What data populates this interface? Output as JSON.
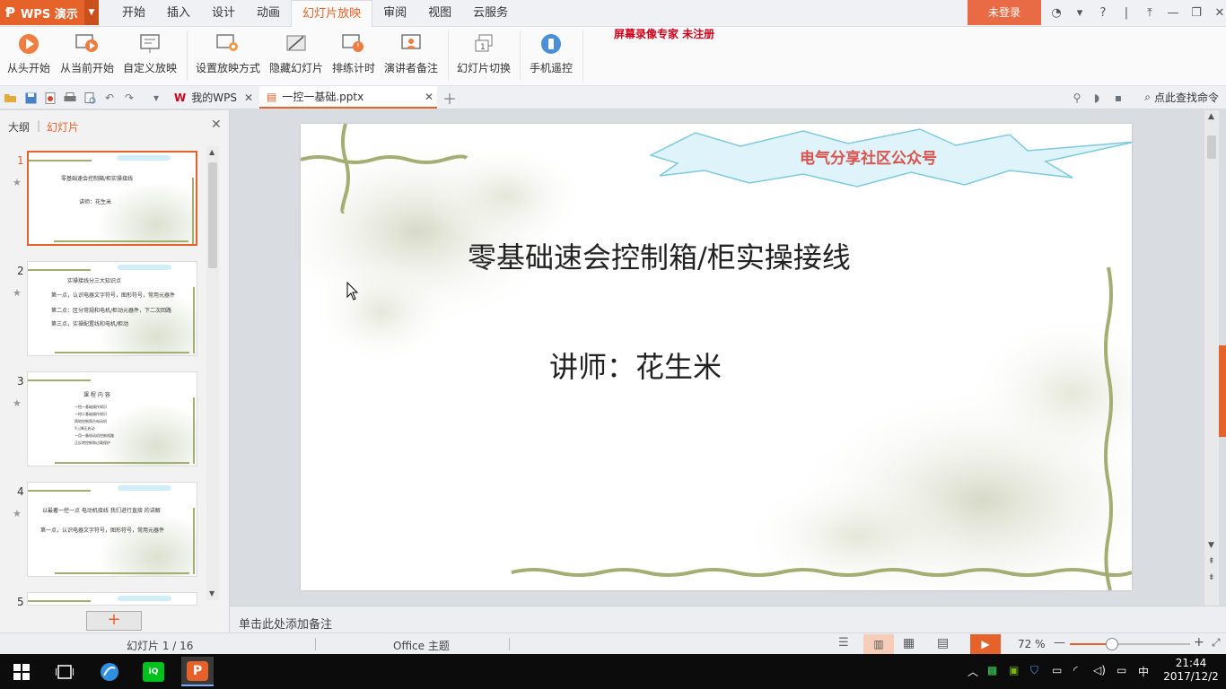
{
  "app": {
    "name": "WPS 演示"
  },
  "menu": {
    "tabs": [
      "开始",
      "插入",
      "设计",
      "动画",
      "幻灯片放映",
      "审阅",
      "视图",
      "云服务"
    ],
    "active_tab": "幻灯片放映",
    "login": "未登录"
  },
  "ribbon": {
    "buttons": [
      "从头开始",
      "从当前开始",
      "自定义放映",
      "设置放映方式",
      "隐藏幻灯片",
      "排练计时",
      "演讲者备注",
      "幻灯片切换",
      "手机遥控"
    ],
    "watermark": "屏幕录像专家  未注册"
  },
  "doc_tabs": [
    {
      "label": "我的WPS"
    },
    {
      "label": "一控一基础.pptx",
      "active": true
    }
  ],
  "find": {
    "label": "点此查找命令"
  },
  "left_panel": {
    "outline_tab": "大纲",
    "slides_tab": "幻灯片",
    "thumbnails": [
      {
        "num": "1",
        "lines": [
          "零基础速会控制箱/柜实操接线",
          "讲师：花生米"
        ]
      },
      {
        "num": "2",
        "lines": [
          "实操接线分三大知识点",
          "第一点，认识电器文字符号，图形符号，常用元器件",
          "第二点：区分常规和电机/柜动元器件，下二次回路",
          "第三点，实操配置线和电机/柜动"
        ]
      },
      {
        "num": "3",
        "lines": [
          "课 程 内 容",
          "一控一基础操作知识",
          "一控二基础操作知识",
          "两地控制两台电动机",
          "Y-△降压启动",
          "一用一备电动机控制线路",
          "正反转控制和过载保护"
        ]
      },
      {
        "num": "4",
        "lines": [
          "以最著一控一点 电动机接线 我们进行直接 的讲解",
          "第一点，认识电器文字符号，图形符号，常用元器件"
        ]
      },
      {
        "num": "5",
        "lines": []
      }
    ]
  },
  "slide": {
    "banner": "电气分享社区公众号",
    "title": "零基础速会控制箱/柜实操接线",
    "subtitle": "讲师：花生米"
  },
  "notes": {
    "placeholder": "单击此处添加备注"
  },
  "status": {
    "slide_counter": "幻灯片 1 / 16",
    "theme": "Office 主题",
    "zoom": "72 %",
    "zoom_level_percent": 72
  },
  "taskbar": {
    "time": "21:44",
    "date": "2017/12/2",
    "ime": "中"
  },
  "colors": {
    "accent": "#e5632b",
    "watermark": "#d0021b"
  }
}
